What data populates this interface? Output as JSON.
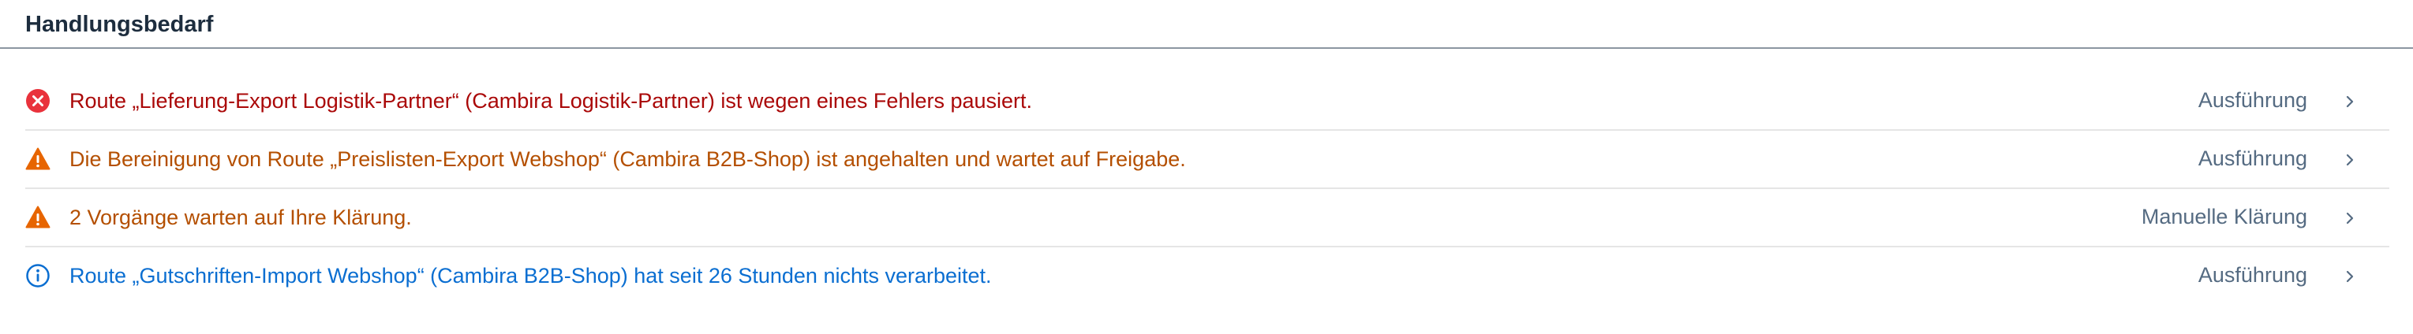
{
  "panel": {
    "title": "Handlungsbedarf"
  },
  "colors": {
    "error": "#e9323c",
    "warning": "#e76500",
    "info": "#0a6ed1",
    "error_text": "#aa0808",
    "warning_text": "#b44f00",
    "info_text": "#0a6ed1",
    "action_text": "#556b82"
  },
  "items": [
    {
      "severity": "error",
      "icon": "error-circle-icon",
      "message": "Route „Lieferung-Export Logistik-Partner“ (Cambira Logistik-Partner) ist wegen eines Fehlers pausiert.",
      "action": "Ausführung"
    },
    {
      "severity": "warning",
      "icon": "warning-triangle-icon",
      "message": "Die Bereinigung von Route „Preislisten-Export Webshop“ (Cambira B2B-Shop) ist angehalten und wartet auf Freigabe.",
      "action": "Ausführung"
    },
    {
      "severity": "warning",
      "icon": "warning-triangle-icon",
      "message": "2 Vorgänge warten auf Ihre Klärung.",
      "action": "Manuelle Klärung"
    },
    {
      "severity": "info",
      "icon": "info-circle-icon",
      "message": "Route „Gutschriften-Import Webshop“ (Cambira B2B-Shop) hat seit 26 Stunden nichts verarbeitet.",
      "action": "Ausführung"
    }
  ]
}
